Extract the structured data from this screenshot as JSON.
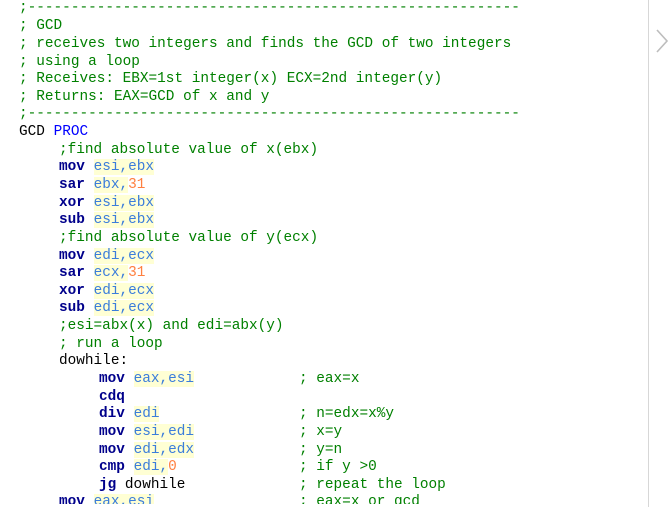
{
  "code": {
    "header": [
      ";---------------------------------------------------------",
      "; GCD",
      "; receives two integers and finds the GCD of two integers",
      "; using a loop",
      "; Receives: EBX=1st integer(x) ECX=2nd integer(y)",
      "; Returns: EAX=GCD of x and y",
      ";---------------------------------------------------------"
    ],
    "proc": {
      "name": "GCD",
      "keyword": "PROC"
    },
    "comments": {
      "abs_x": ";find absolute value of x(ebx)",
      "abs_y": ";find absolute value of y(ecx)",
      "esi_edi": ";esi=abx(x) and edi=abx(y)",
      "run_loop": "; run a loop"
    },
    "label_dowhile": "dowhile:",
    "mnemonics": {
      "mov": "mov",
      "sar": "sar",
      "xor": "xor",
      "sub": "sub",
      "cdq": "cdq",
      "div": "div",
      "cmp": "cmp",
      "jg": "jg"
    },
    "regs": {
      "esi": "esi",
      "ebx": "ebx",
      "edi": "edi",
      "ecx": "ecx",
      "eax": "eax",
      "edx": "edx"
    },
    "nums": {
      "n31": "31",
      "n0": "0"
    },
    "jg_target": "dowhile",
    "loop_comments": [
      "; eax=x",
      "; n=edx=x%y",
      "; x=y",
      "; y=n",
      "; if y >0",
      "; repeat the loop",
      "; eax=x or gcd"
    ],
    "comma": ","
  }
}
